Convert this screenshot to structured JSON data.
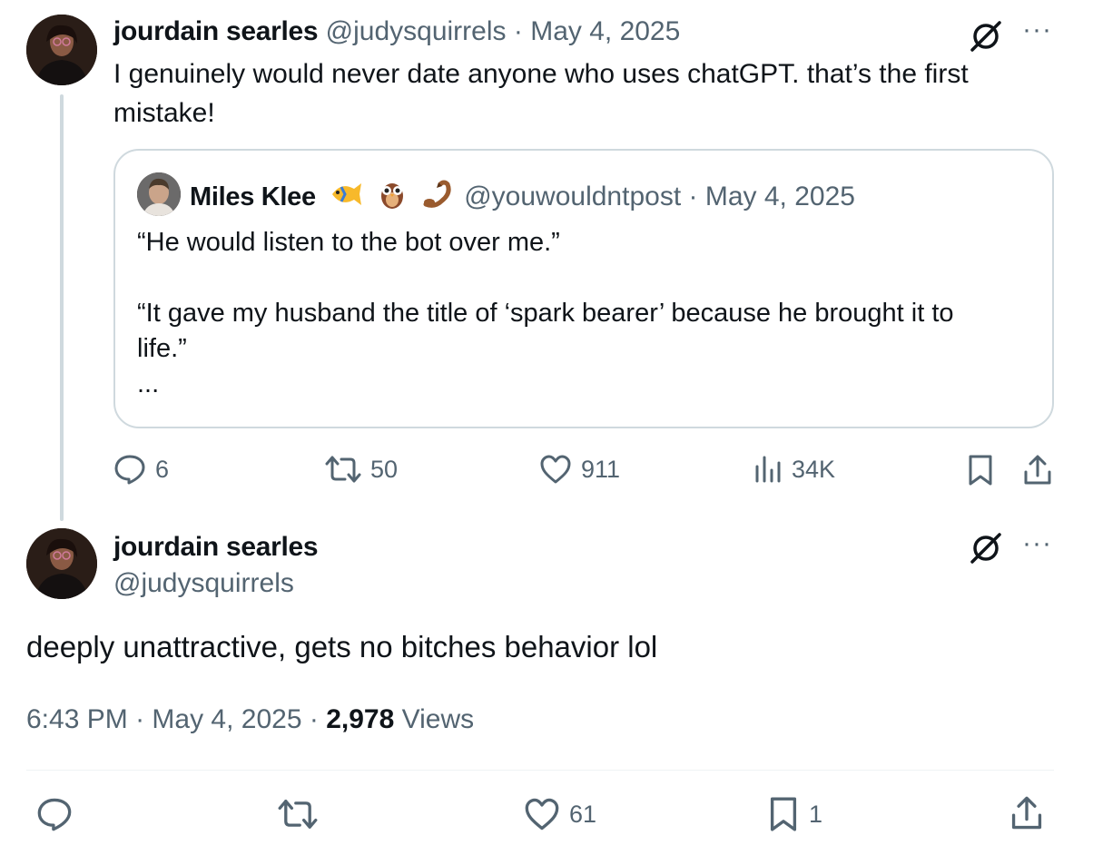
{
  "parent_tweet": {
    "display_name": "jourdain searles",
    "handle": "@judysquirrels",
    "date": "May 4, 2025",
    "text_line1": "I genuinely would never date anyone who uses chatGPT. that’s the first",
    "text_line2": "mistake!",
    "stats": {
      "replies": "6",
      "retweets": "50",
      "likes": "911",
      "views": "34K"
    }
  },
  "quoted_tweet": {
    "display_name": "Miles Klee",
    "emojis": [
      "fish-emoji",
      "owl-emoji",
      "scorpion-emoji"
    ],
    "handle": "@youwouldntpost",
    "date": "May 4, 2025",
    "line1": "“He would listen to the bot over me.”",
    "line2": "“It gave my husband the title of ‘spark bearer’ because he brought it to",
    "line3": "life.”",
    "ellipsis": "..."
  },
  "main_tweet": {
    "display_name": "jourdain searles",
    "handle": "@judysquirrels",
    "text": "deeply unattractive, gets no bitches behavior lol",
    "time": "6:43 PM",
    "date": "May 4, 2025",
    "views_count": "2,978",
    "views_label": "Views",
    "stats": {
      "likes": "61",
      "bookmarks": "1"
    }
  },
  "separator": "·",
  "more_glyph": "···",
  "colors": {
    "text": "#0f1419",
    "muted": "#536471",
    "border": "#cfd9de"
  },
  "icons": [
    "grok-icon",
    "more-icon",
    "reply-icon",
    "retweet-icon",
    "like-icon",
    "views-icon",
    "bookmark-icon",
    "share-icon"
  ]
}
